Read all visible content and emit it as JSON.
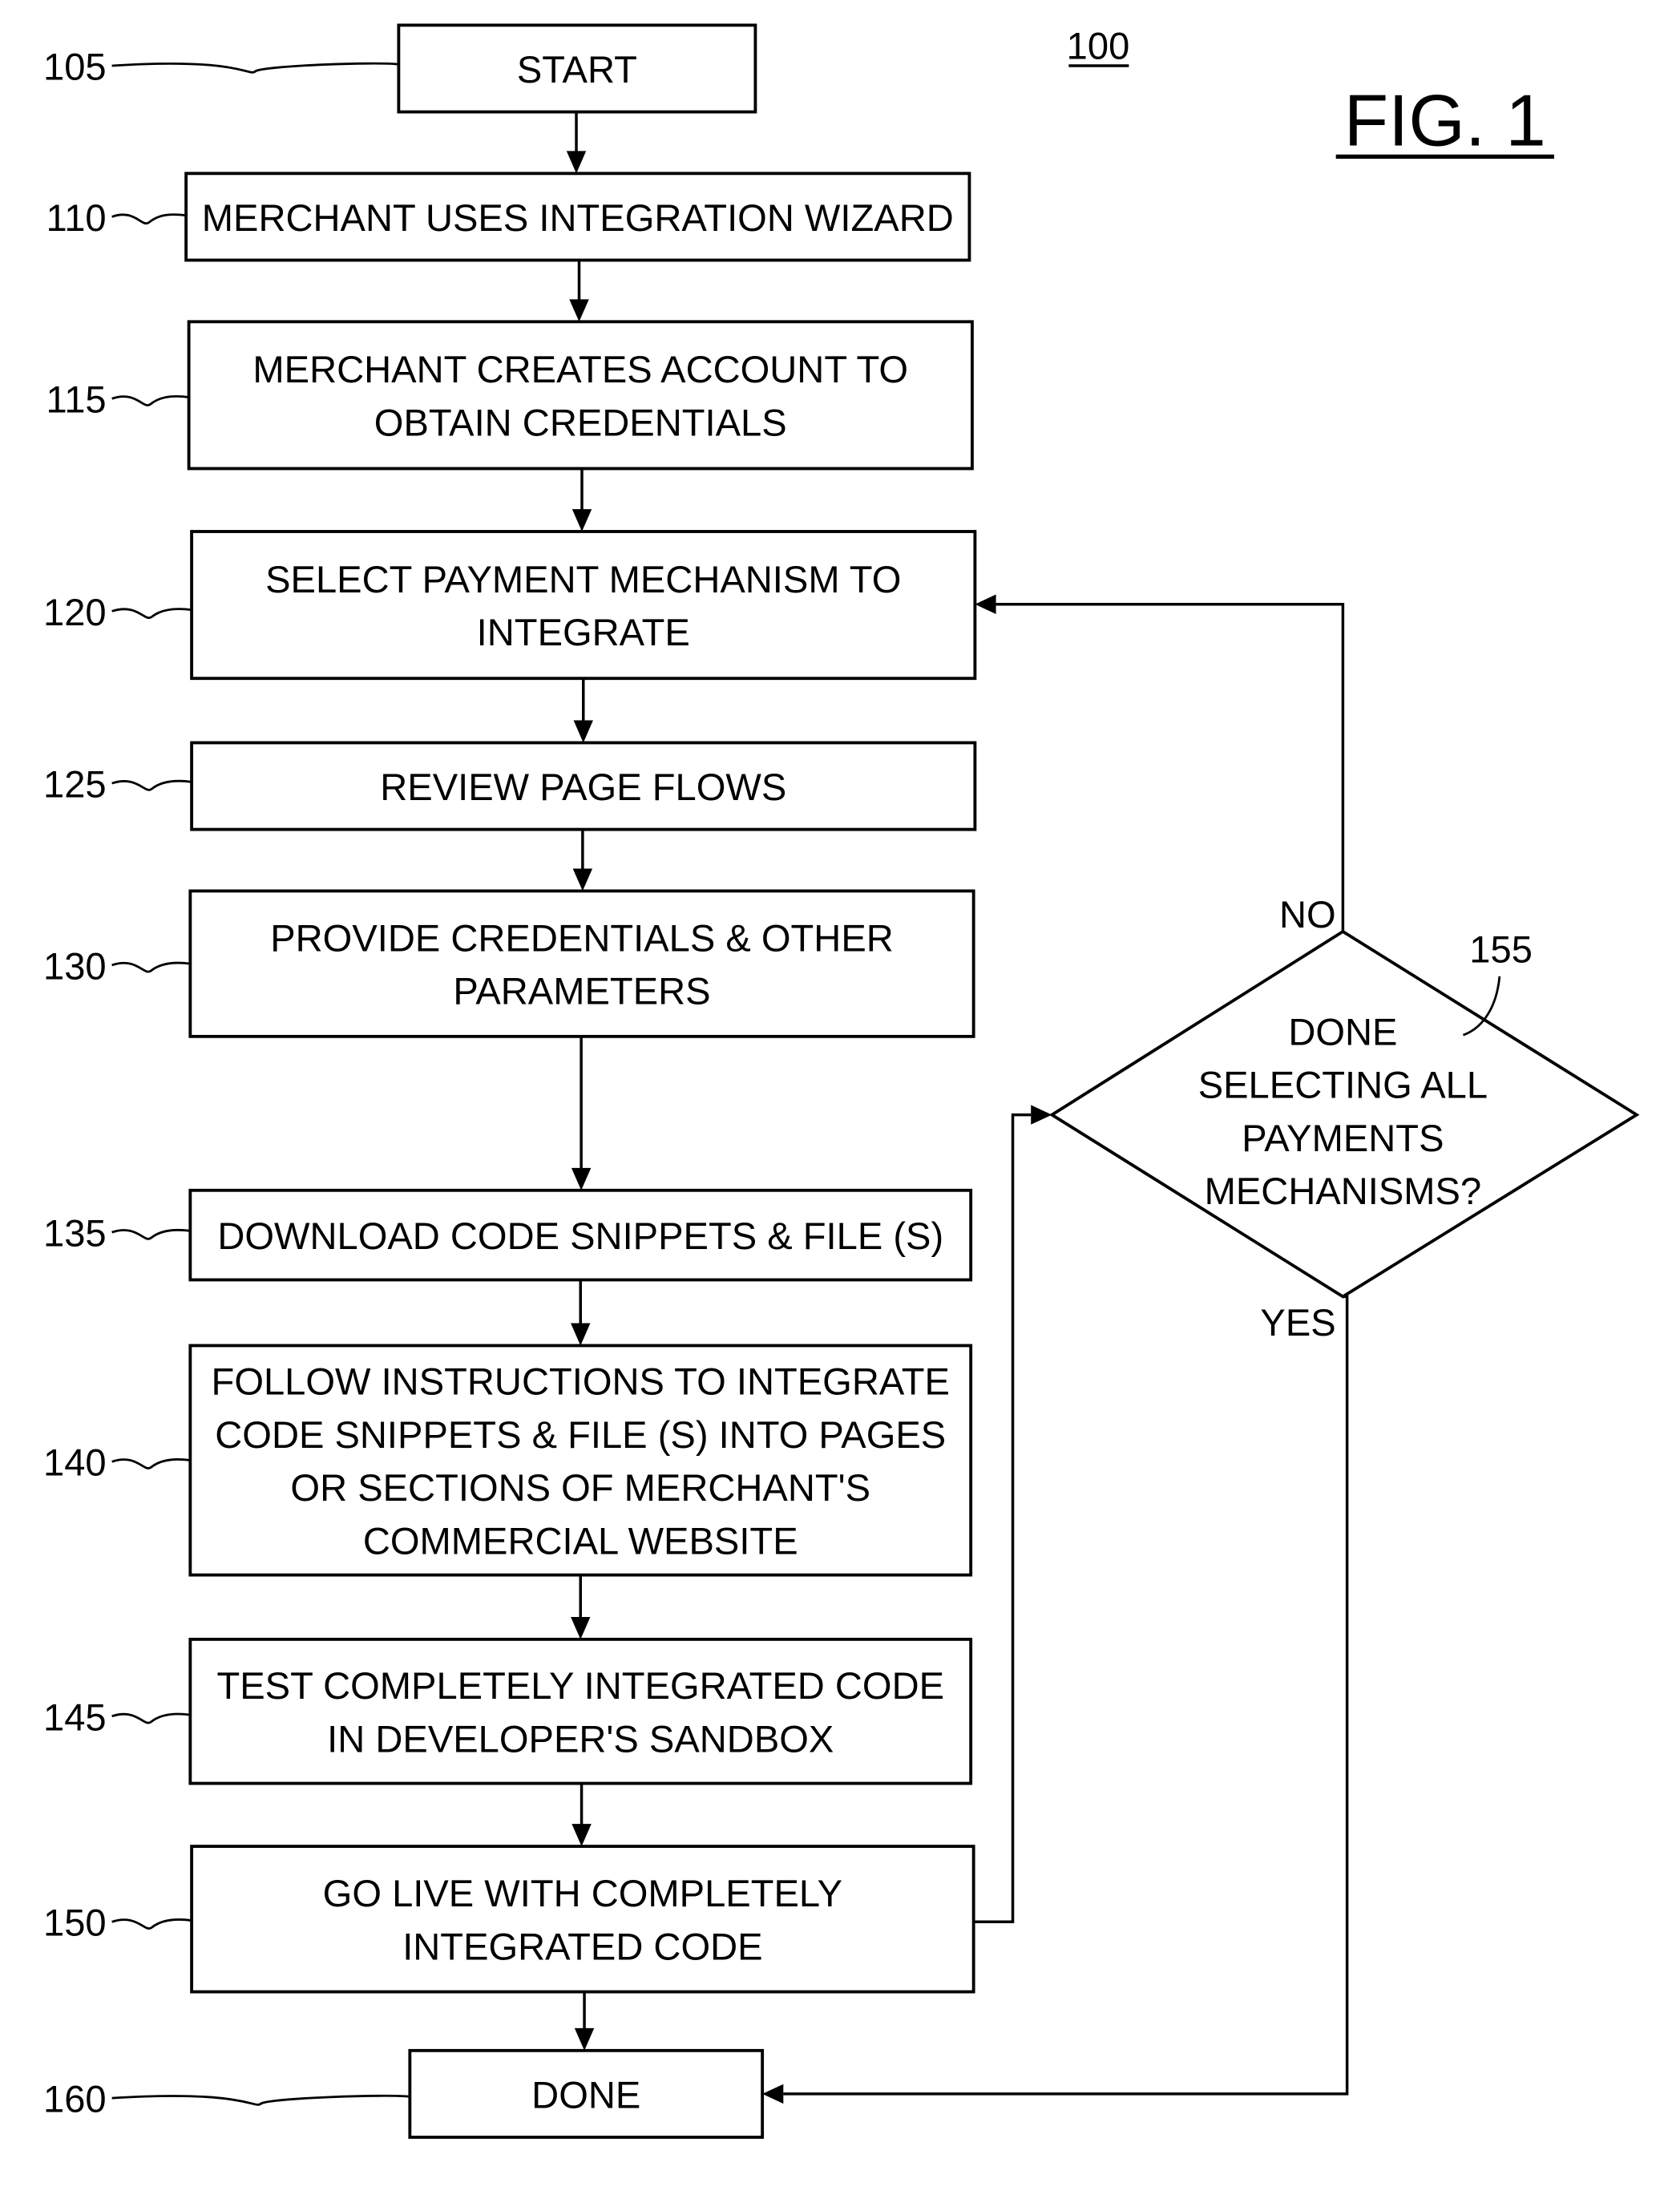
{
  "figure": {
    "figure_number": "100",
    "figure_label": "FIG. 1"
  },
  "steps": [
    {
      "ref": "105",
      "lines": [
        "START"
      ]
    },
    {
      "ref": "110",
      "lines": [
        "MERCHANT USES INTEGRATION WIZARD"
      ]
    },
    {
      "ref": "115",
      "lines": [
        "MERCHANT CREATES ACCOUNT TO",
        "OBTAIN CREDENTIALS"
      ]
    },
    {
      "ref": "120",
      "lines": [
        "SELECT PAYMENT MECHANISM TO",
        "INTEGRATE"
      ]
    },
    {
      "ref": "125",
      "lines": [
        "REVIEW PAGE FLOWS"
      ]
    },
    {
      "ref": "130",
      "lines": [
        "PROVIDE CREDENTIALS & OTHER",
        "PARAMETERS"
      ]
    },
    {
      "ref": "135",
      "lines": [
        "DOWNLOAD CODE SNIPPETS & FILE (S)"
      ]
    },
    {
      "ref": "140",
      "lines": [
        "FOLLOW INSTRUCTIONS TO INTEGRATE",
        "CODE SNIPPETS & FILE (S) INTO PAGES",
        "OR SECTIONS OF MERCHANT'S",
        "COMMERCIAL WEBSITE"
      ]
    },
    {
      "ref": "145",
      "lines": [
        "TEST COMPLETELY INTEGRATED CODE",
        "IN DEVELOPER'S SANDBOX"
      ]
    },
    {
      "ref": "150",
      "lines": [
        "GO LIVE WITH COMPLETELY",
        "INTEGRATED CODE"
      ]
    },
    {
      "ref": "160",
      "lines": [
        "DONE"
      ]
    }
  ],
  "decision": {
    "ref": "155",
    "lines": [
      "DONE",
      "SELECTING ALL",
      "PAYMENTS",
      "MECHANISMS?"
    ],
    "no_label": "NO",
    "yes_label": "YES"
  }
}
